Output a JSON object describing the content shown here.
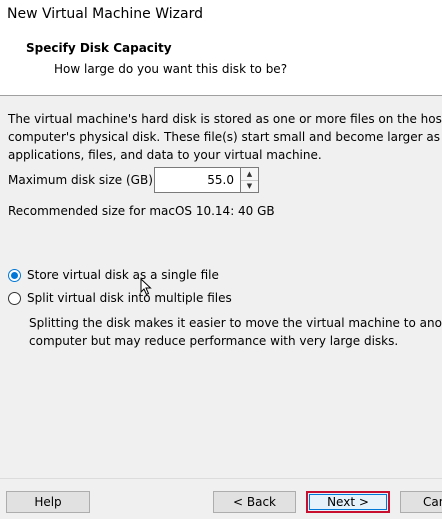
{
  "window": {
    "title": "New Virtual Machine Wizard"
  },
  "header": {
    "title": "Specify Disk Capacity",
    "subtitle": "How large do you want this disk to be?"
  },
  "description": {
    "line1": "The virtual machine's hard disk is stored as one or more files on the host",
    "line2": "computer's physical disk. These file(s) start small and become larger as you",
    "line3": "applications, files, and data to your virtual machine."
  },
  "disk_size": {
    "label": "Maximum disk size (GB):",
    "value": "55.0",
    "up_glyph": "▲",
    "down_glyph": "▼"
  },
  "recommended": "Recommended size for macOS 10.14: 40 GB",
  "options": {
    "single": {
      "label": "Store virtual disk as a single file",
      "selected": true
    },
    "split": {
      "label": "Split virtual disk into multiple files",
      "selected": false
    }
  },
  "split_description": {
    "line1": "Splitting the disk makes it easier to move the virtual machine to another",
    "line2": "computer but may reduce performance with very large disks."
  },
  "buttons": {
    "help": "Help",
    "back": "< Back",
    "next": "Next >",
    "cancel": "Cancel"
  },
  "colors": {
    "accent": "#0078d7",
    "highlight_border": "#c8102e"
  }
}
